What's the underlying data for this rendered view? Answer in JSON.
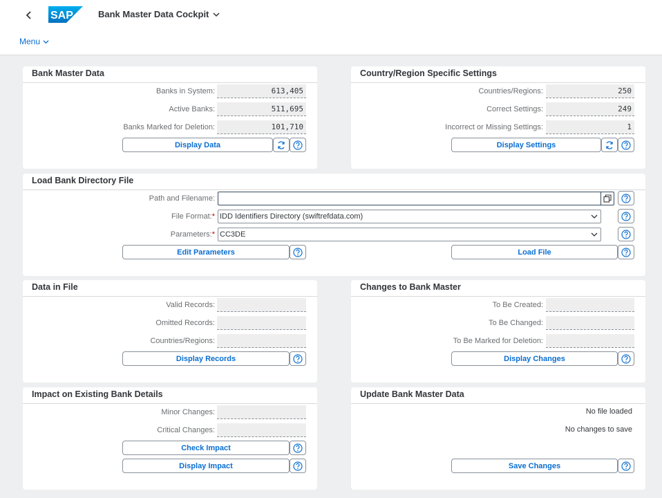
{
  "shell": {
    "app_title": "Bank Master Data Cockpit",
    "menu_label": "Menu",
    "logo_text": "SAP"
  },
  "bank_master": {
    "title": "Bank Master Data",
    "banks_in_system_label": "Banks in System:",
    "banks_in_system_value": "613,405",
    "active_banks_label": "Active Banks:",
    "active_banks_value": "511,695",
    "marked_for_deletion_label": "Banks Marked for Deletion:",
    "marked_for_deletion_value": "101,710",
    "display_button": "Display Data"
  },
  "country_settings": {
    "title": "Country/Region Specific Settings",
    "countries_label": "Countries/Regions:",
    "countries_value": "250",
    "correct_label": "Correct Settings:",
    "correct_value": "249",
    "incorrect_label": "Incorrect or Missing Settings:",
    "incorrect_value": "1",
    "display_button": "Display Settings"
  },
  "load_file": {
    "title": "Load Bank Directory File",
    "path_label": "Path and Filename:",
    "path_value": "",
    "format_label": "File Format:",
    "format_value": "IDD Identifiers Directory (swiftrefdata.com)",
    "params_label": "Parameters:",
    "params_value": "CC3DE",
    "edit_params_button": "Edit Parameters",
    "load_file_button": "Load File"
  },
  "data_in_file": {
    "title": "Data in File",
    "valid_label": "Valid Records:",
    "valid_value": "",
    "omitted_label": "Omitted Records:",
    "omitted_value": "",
    "countries_label": "Countries/Regions:",
    "countries_value": "",
    "display_button": "Display Records"
  },
  "changes": {
    "title": "Changes to Bank Master",
    "created_label": "To Be Created:",
    "created_value": "",
    "changed_label": "To Be Changed:",
    "changed_value": "",
    "deleted_label": "To Be Marked for Deletion:",
    "deleted_value": "",
    "display_button": "Display Changes"
  },
  "impact": {
    "title": "Impact on Existing Bank Details",
    "minor_label": "Minor Changes:",
    "minor_value": "",
    "critical_label": "Critical Changes:",
    "critical_value": "",
    "check_button": "Check Impact",
    "display_button": "Display Impact"
  },
  "update": {
    "title": "Update Bank Master Data",
    "status_file": "No file loaded",
    "status_changes": "No changes to save",
    "save_button": "Save Changes"
  },
  "colors": {
    "accent": "#0a6ed1",
    "logo_blue": "#0a6ed1",
    "required": "#bb0000"
  }
}
